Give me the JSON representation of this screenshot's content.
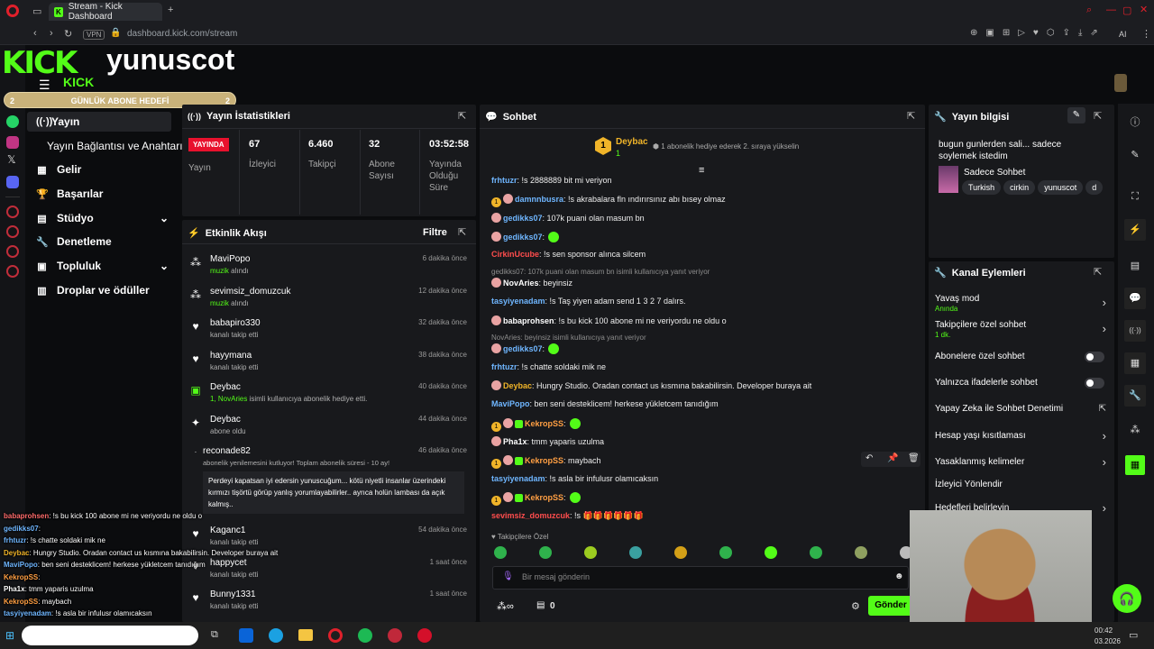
{
  "browser": {
    "tab_title": "Stream - Kick Dashboard",
    "vpn": "VPN",
    "url": "dashboard.kick.com/stream",
    "ai": "AI"
  },
  "overlay": {
    "logo": "KICK",
    "name": "yunuscot",
    "goal_left": "2",
    "goal_label": "GÜNLÜK ABONE HEDEFİ",
    "goal_right": "2",
    "chat": [
      {
        "user": "babaprohsen",
        "text": ": !s bu kick 100 abone mi ne veriyordu ne oldu o",
        "color": "#ff6b6b"
      },
      {
        "user": "gedikks07",
        "text": ":",
        "color": "#6fb6ff"
      },
      {
        "user": "frhtuzr",
        "text": ": !s chatte soldaki mik ne",
        "color": "#6fb6ff"
      },
      {
        "user": "Deybac",
        "text": ": Hungry Studio. Oradan contact us kısmına bakabilirsin. Developer buraya ait",
        "color": "#f0b429"
      },
      {
        "user": "MaviPopo",
        "text": ": ben seni desteklicem! herkese yükletcem tanıdığım",
        "color": "#6fb6ff"
      },
      {
        "user": "KekropSS",
        "text": ":",
        "color": "#ff9f43"
      },
      {
        "user": "Pha1x",
        "text": ": tmm yaparis uzulma",
        "color": "#fff"
      },
      {
        "user": "KekropSS",
        "text": ": maybach",
        "color": "#ff9f43"
      },
      {
        "user": "tasyiyenadam",
        "text": ": !s asla bir infulusr olamıcaksın",
        "color": "#6fb6ff"
      }
    ]
  },
  "nav": {
    "items": [
      {
        "label": "Yayın",
        "icon": "broadcast-icon"
      },
      {
        "label": "Yayın Bağlantısı ve Anahtarı",
        "icon": ""
      },
      {
        "label": "Gelir",
        "icon": "chart-icon"
      },
      {
        "label": "Başarılar",
        "icon": "trophy-icon"
      },
      {
        "label": "Stüdyo",
        "icon": "studio-icon"
      },
      {
        "label": "Denetleme",
        "icon": "wrench-icon"
      },
      {
        "label": "Topluluk",
        "icon": "community-icon"
      },
      {
        "label": "Droplar ve ödüller",
        "icon": "gift-icon"
      }
    ]
  },
  "stats": {
    "title": "Yayın İstatistikleri",
    "live_badge": "YAYINDA",
    "live_label": "Yayın",
    "viewers": "67",
    "viewers_label": "İzleyici",
    "followers": "6.460",
    "followers_label": "Takipçi",
    "subs": "32",
    "subs_label": "Abone Sayısı",
    "uptime": "03:52:58",
    "uptime_label": "Yayında Olduğu Süre"
  },
  "activity": {
    "title": "Etkinlik Akışı",
    "filter": "Filtre",
    "items": [
      {
        "name": "MaviPopo",
        "sub_hl": "muzik",
        "sub": " alındı",
        "time": "6 dakika önce"
      },
      {
        "name": "sevimsiz_domuzcuk",
        "sub_hl": "muzik",
        "sub": " alındı",
        "time": "12 dakika önce"
      },
      {
        "name": "babapiro330",
        "sub_hl": "",
        "sub": "kanalı takip etti",
        "time": "32 dakika önce"
      },
      {
        "name": "hayymana",
        "sub_hl": "",
        "sub": "kanalı takip etti",
        "time": "38 dakika önce"
      },
      {
        "name": "Deybac",
        "sub_hl": "1, NovAries",
        "sub": " isimli kullanıcıya abonelik hediye etti.",
        "time": "40 dakika önce"
      },
      {
        "name": "Deybac",
        "sub_hl": "",
        "sub": "abone oldu",
        "time": "44 dakika önce"
      },
      {
        "name": "reconade82",
        "sub_hl": "",
        "sub": "abonelik yenilemesini kutluyor! Toplam abonelik süresi - 10 ay!",
        "time": "46 dakika önce"
      },
      {
        "name": "Kaganc1",
        "sub_hl": "",
        "sub": "kanalı takip etti",
        "time": "54 dakika önce"
      },
      {
        "name": "happycet",
        "sub_hl": "",
        "sub": "kanalı takip etti",
        "time": "1 saat önce"
      },
      {
        "name": "Bunny1331",
        "sub_hl": "",
        "sub": "kanalı takip etti",
        "time": "1 saat önce"
      }
    ],
    "resub_message": "Perdeyi kapatsan iyi edersin yunuscuğum... kötü niyetli insanlar üzerindeki kırmızı tişörtü görüp yanlış yorumlayabilirler.. ayrıca holün lambası da açık kalmış.."
  },
  "chat": {
    "title": "Sohbet",
    "pinned_user": "Deybac",
    "pinned_rank": "1",
    "pinned_count": "1",
    "pinned_text": "1 abonelik hediye ederek 2. sıraya yükselin",
    "messages": [
      {
        "user": "frhtuzr",
        "text": ": !s 2888889 bit mi veriyon",
        "color": "#6fb6ff",
        "badges": ""
      },
      {
        "user": "damnnbusra",
        "text": ": !s akrabalara fln ındırırsınız abı bısey olmaz",
        "color": "#6fb6ff",
        "badges": "gold-pig"
      },
      {
        "user": "gedikks07",
        "text": ": 107k puani olan masum bn",
        "color": "#6fb6ff",
        "badges": "pig"
      },
      {
        "user": "gedikks07",
        "text": ":",
        "color": "#6fb6ff",
        "badges": "pig",
        "emote": true
      },
      {
        "user": "CirkinUcube",
        "text": ": !s sen sponsor alınca silcem",
        "color": "#ff4d4d",
        "badges": ""
      },
      {
        "reply": "gedikks07: 107k puani olan masum bn isimli kullanıcıya yanıt veriyor"
      },
      {
        "user": "NovAries",
        "text": ": beyinsiz",
        "color": "#fff",
        "badges": "pig"
      },
      {
        "user": "tasyiyenadam",
        "text": ": !s Taş yiyen adam send 1 3 2 7 dalırs.",
        "color": "#6fb6ff",
        "badges": ""
      },
      {
        "user": "babaprohsen",
        "text": ": !s bu kick 100 abone mi ne veriyordu ne oldu o",
        "color": "#fff",
        "badges": "pig"
      },
      {
        "reply": "NovAries: beyinsiz isimli kullanıcıya yanıt veriyor"
      },
      {
        "user": "gedikks07",
        "text": ":",
        "color": "#6fb6ff",
        "badges": "pig",
        "emote": true
      },
      {
        "user": "frhtuzr",
        "text": ": !s chatte soldaki mik ne",
        "color": "#6fb6ff",
        "badges": ""
      },
      {
        "user": "Deybac",
        "text": ": Hungry Studio. Oradan contact us kısmına bakabilirsin. Developer buraya ait",
        "color": "#f0b429",
        "badges": "pig"
      },
      {
        "user": "MaviPopo",
        "text": ": ben seni desteklicem! herkese yükletcem tanıdığım",
        "color": "#6fb6ff",
        "badges": ""
      },
      {
        "user": "KekropSS",
        "text": ":",
        "color": "#ff9f43",
        "badges": "gold-pig-sub",
        "emote": true
      },
      {
        "user": "Pha1x",
        "text": ": tmm yaparis uzulma",
        "color": "#fff",
        "badges": "pig"
      },
      {
        "user": "KekropSS",
        "text": ": maybach",
        "color": "#ff9f43",
        "badges": "gold-pig-sub"
      },
      {
        "user": "tasyiyenadam",
        "text": ": !s asla bir infulusr olamıcaksın",
        "color": "#6fb6ff",
        "badges": ""
      },
      {
        "user": "KekropSS",
        "text": ":",
        "color": "#ff9f43",
        "badges": "gold-pig-sub",
        "emote": true
      },
      {
        "user": "sevimsiz_domuzcuk",
        "text": ": !s 🎁🎁🎁🎁🎁🎁",
        "color": "#ff4d4d",
        "badges": ""
      }
    ],
    "emote_bar_label": "Takipçilere Özel",
    "input_placeholder": "Bir mesaj gönderin",
    "points": "0",
    "send": "Gönder"
  },
  "stream_info": {
    "title": "Yayın bilgisi",
    "stream_title": "bugun gunlerden sali... sadece soylemek istedim",
    "category": "Sadece Sohbet",
    "tags": [
      "Turkish",
      "cirkin",
      "yunuscot",
      "d"
    ]
  },
  "channel_actions": {
    "title": "Kanal Eylemleri",
    "rows": [
      {
        "label": "Yavaş mod",
        "sub": "Anında",
        "control": "chevron"
      },
      {
        "label": "Takipçilere özel sohbet",
        "sub": "1 dk.",
        "control": "chevron"
      },
      {
        "label": "Abonelere özel sohbet",
        "sub": "",
        "control": "toggle"
      },
      {
        "label": "Yalnızca ifadelerle sohbet",
        "sub": "",
        "control": "toggle"
      },
      {
        "label": "Yapay Zeka ile Sohbet Denetimi",
        "sub": "",
        "control": "external"
      },
      {
        "label": "Hesap yaşı kısıtlaması",
        "sub": "",
        "control": "chevron"
      },
      {
        "label": "Yasaklanmış kelimeler",
        "sub": "",
        "control": "chevron"
      },
      {
        "label": "İzleyici Yönlendir",
        "sub": "",
        "control": ""
      },
      {
        "label": "Hedefleri belirleyin",
        "sub": "",
        "control": "chevron"
      }
    ]
  },
  "taskbar": {
    "time": "00:42",
    "date": "03.2026"
  },
  "colors": {
    "brand": "#53fc18",
    "live": "#e8112d",
    "bg": "#0b0c0e",
    "panel": "#18191c"
  }
}
